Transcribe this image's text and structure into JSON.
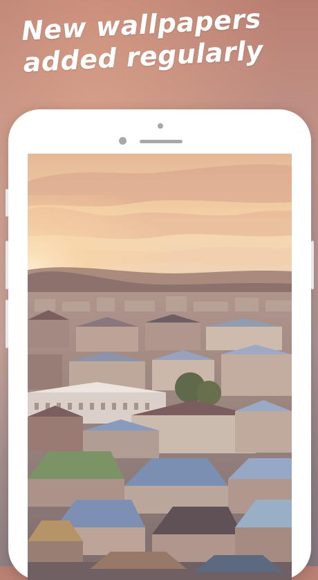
{
  "headline": {
    "line1": "New wallpapers",
    "line2": "added regularly"
  },
  "colors": {
    "background": "#c69a8e",
    "headline_text": "#ffffff",
    "phone_frame": "#ffffff"
  },
  "wallpaper": {
    "subject": "city-skyline-at-sunset"
  }
}
